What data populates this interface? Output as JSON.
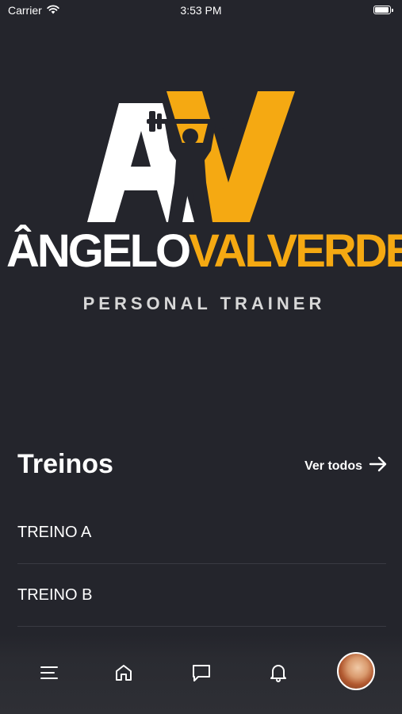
{
  "status_bar": {
    "carrier": "Carrier",
    "time": "3:53 PM"
  },
  "logo": {
    "monogram": "AV",
    "first_name": "ÂNGELO",
    "last_name": "VALVERDE",
    "subtitle": "PERSONAL TRAINER",
    "colors": {
      "white": "#ffffff",
      "gold": "#f5a912"
    }
  },
  "section": {
    "title": "Treinos",
    "see_all_label": "Ver todos",
    "items": [
      {
        "label": "TREINO A"
      },
      {
        "label": "TREINO B"
      }
    ]
  },
  "bottom_nav": {
    "items": [
      {
        "icon": "menu-icon"
      },
      {
        "icon": "home-icon"
      },
      {
        "icon": "chat-icon"
      },
      {
        "icon": "bell-icon"
      },
      {
        "icon": "avatar"
      }
    ]
  },
  "colors": {
    "background": "#24252c",
    "accent": "#f5a912",
    "divider": "#3a3b43"
  }
}
